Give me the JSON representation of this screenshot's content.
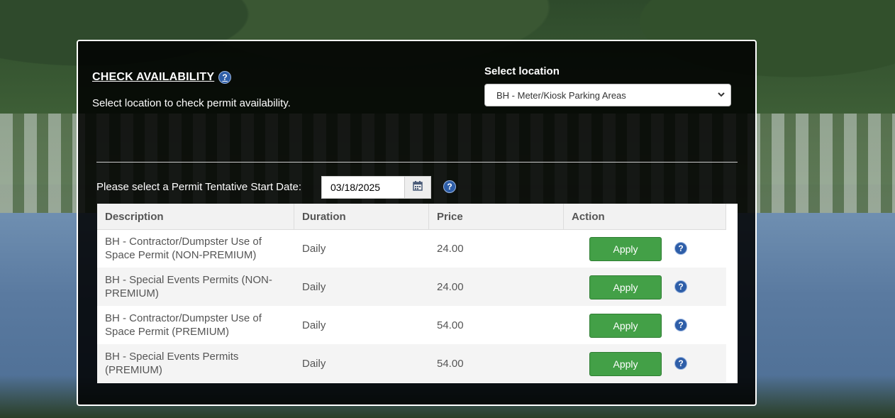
{
  "header": {
    "title": "CHECK AVAILABILITY",
    "subtitle": "Select location to check permit availability."
  },
  "location": {
    "label": "Select location",
    "selected": "BH - Meter/Kiosk Parking Areas"
  },
  "date": {
    "label": "Please select a Permit Tentative Start Date:",
    "value": "03/18/2025"
  },
  "help_glyph": "?",
  "table": {
    "headers": [
      "Description",
      "Duration",
      "Price",
      "Action"
    ],
    "rows": [
      {
        "description": "BH - Contractor/Dumpster Use of Space Permit (NON-PREMIUM)",
        "duration": "Daily",
        "price": "24.00",
        "action": "Apply"
      },
      {
        "description": "BH - Special Events Permits (NON-PREMIUM)",
        "duration": "Daily",
        "price": "24.00",
        "action": "Apply"
      },
      {
        "description": "BH - Contractor/Dumpster Use of Space Permit (PREMIUM)",
        "duration": "Daily",
        "price": "54.00",
        "action": "Apply"
      },
      {
        "description": "BH - Special Events Permits (PREMIUM)",
        "duration": "Daily",
        "price": "54.00",
        "action": "Apply"
      }
    ]
  },
  "colors": {
    "apply_button": "#43a047",
    "help_icon": "#2e5ea8",
    "panel_background": "#000000"
  }
}
